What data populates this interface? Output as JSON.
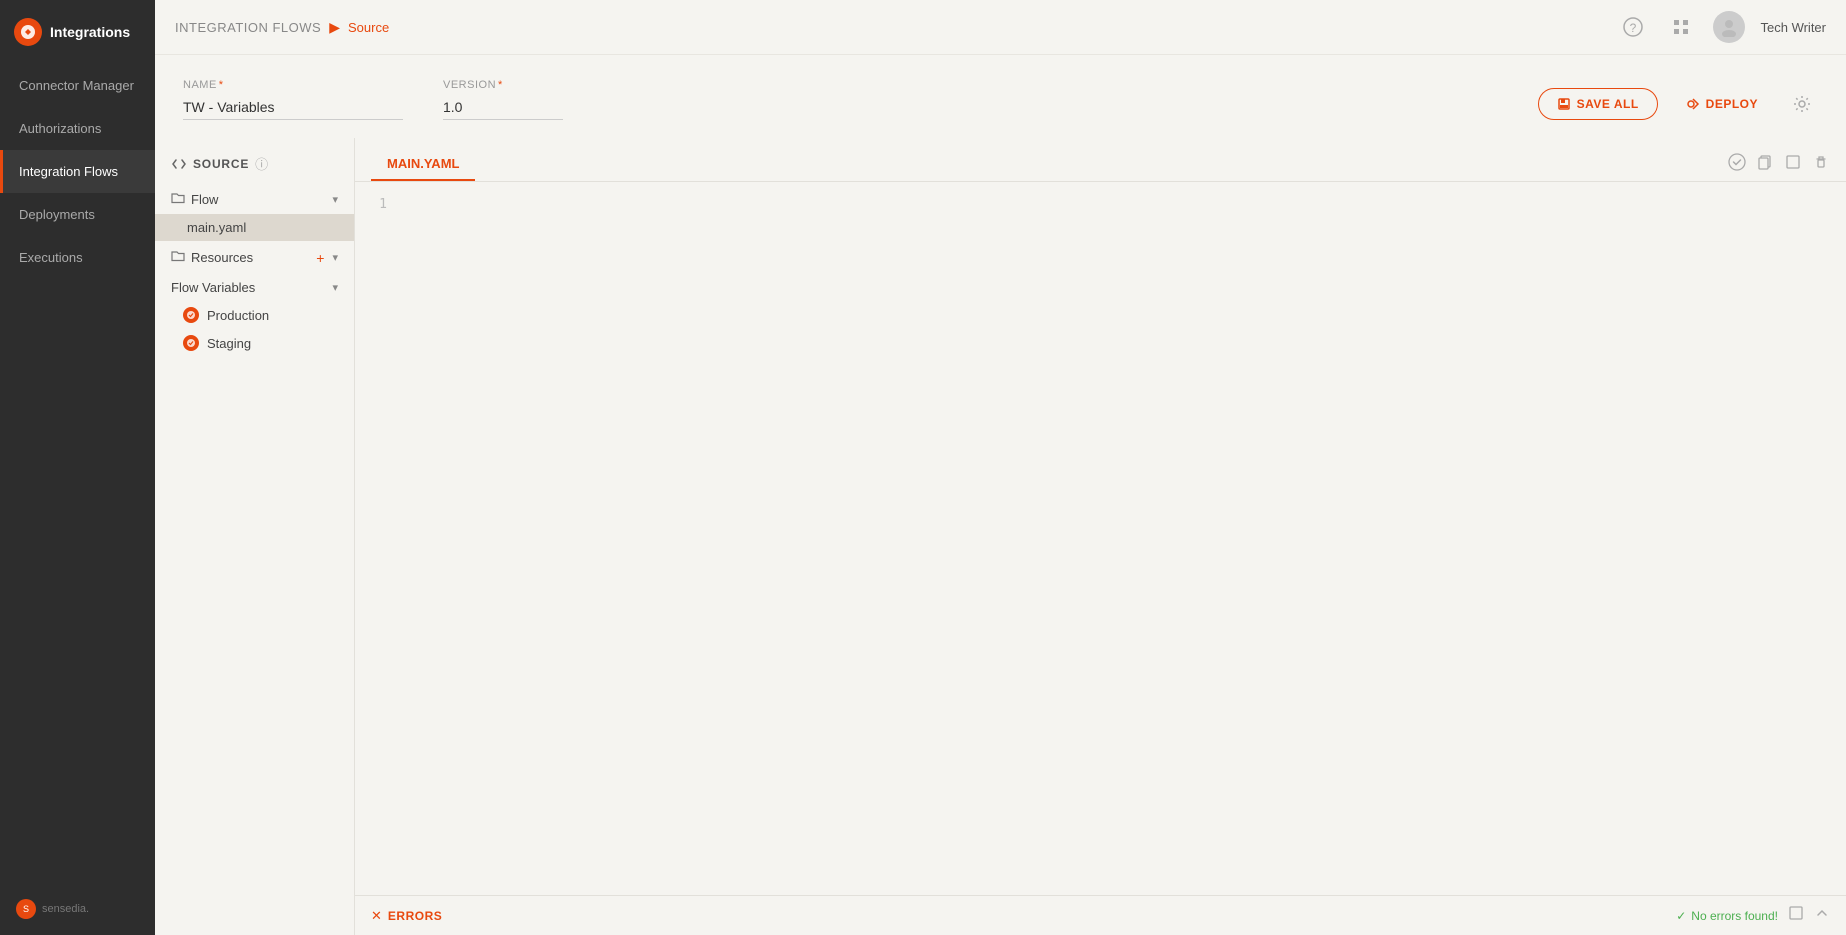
{
  "sidebar": {
    "logo_text": "Integrations",
    "nav_items": [
      {
        "id": "connector-manager",
        "label": "Connector Manager",
        "active": false
      },
      {
        "id": "authorizations",
        "label": "Authorizations",
        "active": false
      },
      {
        "id": "integration-flows",
        "label": "Integration Flows",
        "active": true
      },
      {
        "id": "deployments",
        "label": "Deployments",
        "active": false
      },
      {
        "id": "executions",
        "label": "Executions",
        "active": false
      }
    ],
    "footer_logo": "sensedia"
  },
  "header": {
    "breadcrumb_root": "INTEGRATION FLOWS",
    "breadcrumb_current": "Source",
    "help_icon": "?",
    "grid_icon": "⊞",
    "user_name": "Tech Writer"
  },
  "form": {
    "name_label": "Name",
    "name_required": "*",
    "name_value": "TW - Variables",
    "version_label": "Version",
    "version_required": "*",
    "version_value": "1.0",
    "save_all_label": "SAVE ALL",
    "deploy_label": "DEPLOY"
  },
  "source_panel": {
    "title": "SOURCE",
    "info_icon": "ⓘ",
    "flow_section": {
      "label": "Flow",
      "files": [
        {
          "name": "main.yaml",
          "active": true
        }
      ]
    },
    "resources_section": {
      "label": "Resources"
    },
    "flow_variables_section": {
      "label": "Flow Variables",
      "items": [
        {
          "name": "Production"
        },
        {
          "name": "Staging"
        }
      ]
    }
  },
  "editor": {
    "tab_label": "MAIN.YAML",
    "line_numbers": [
      "1"
    ],
    "code_content": "",
    "icons": {
      "check": "✓",
      "copy": "⧉",
      "expand": "⬜",
      "delete": "🗑"
    }
  },
  "bottom_bar": {
    "errors_label": "ERRORS",
    "no_errors_text": "No errors found!"
  }
}
